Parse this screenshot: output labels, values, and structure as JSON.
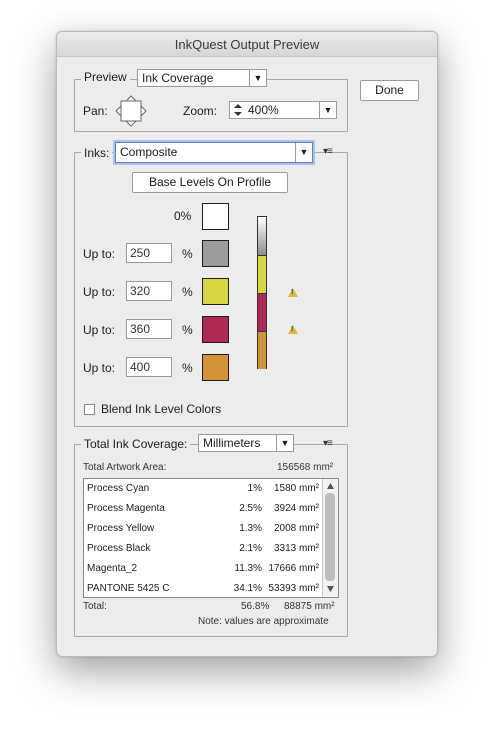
{
  "window": {
    "title": "InkQuest Output Preview"
  },
  "preview": {
    "label": "Preview",
    "mode": "Ink Coverage",
    "pan_label": "Pan:",
    "zoom_label": "Zoom:",
    "zoom_value": "400%",
    "done_label": "Done"
  },
  "inks": {
    "label": "Inks:",
    "selected": "Composite",
    "base_levels_label": "Base Levels On Profile",
    "zero_label": "0%",
    "upto_label": "Up to:",
    "percent_sign": "%",
    "levels": [
      {
        "value": "250",
        "color": "#9c9c9c",
        "warning": false
      },
      {
        "value": "320",
        "color": "#d6d542",
        "warning": true
      },
      {
        "value": "360",
        "color": "#ae2a52",
        "warning": true
      },
      {
        "value": "400",
        "color": "#d39336",
        "warning": false
      }
    ],
    "blend_label": "Blend Ink Level Colors",
    "blend_checked": false
  },
  "coverage": {
    "label": "Total Ink Coverage:",
    "unit": "Millimeters",
    "total_area_label": "Total Artwork Area:",
    "total_area_value": "156568 mm²",
    "rows": [
      {
        "name": "Process Cyan",
        "percent": "1%",
        "area": "1580 mm²"
      },
      {
        "name": "Process Magenta",
        "percent": "2.5%",
        "area": "3924 mm²"
      },
      {
        "name": "Process Yellow",
        "percent": "1.3%",
        "area": "2008 mm²"
      },
      {
        "name": "Process Black",
        "percent": "2.1%",
        "area": "3313 mm²"
      },
      {
        "name": "Magenta_2",
        "percent": "11.3%",
        "area": "17666 mm²"
      },
      {
        "name": "PANTONE 5425 C",
        "percent": "34.1%",
        "area": "53393 mm²"
      }
    ],
    "total_label": "Total:",
    "total_percent": "56.8%",
    "total_area": "88875 mm²",
    "note": "Note: values are approximate"
  },
  "icons": {
    "dropdown": "chevron-down-icon",
    "panel_menu": "panel-menu-icon",
    "pan": "pan-icon",
    "warning": "warning-icon",
    "stepper": "stepper-icon"
  }
}
